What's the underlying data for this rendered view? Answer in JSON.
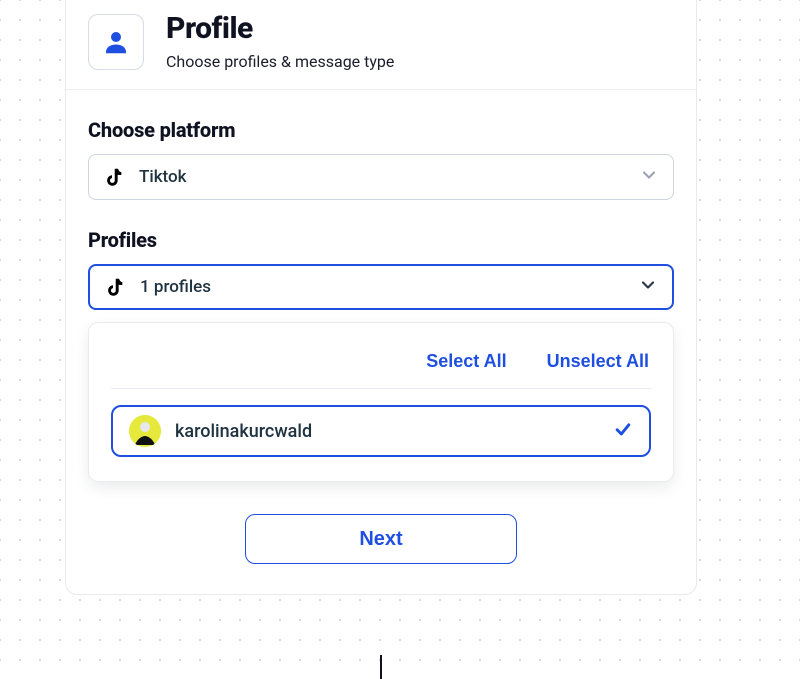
{
  "header": {
    "title": "Profile",
    "subtitle": "Choose profiles & message type",
    "icon": "person-icon"
  },
  "platform": {
    "label": "Choose platform",
    "selected": "Tiktok",
    "icon": "tiktok-icon"
  },
  "profiles": {
    "label": "Profiles",
    "summary": "1 profiles",
    "icon": "tiktok-icon",
    "select_all_label": "Select All",
    "unselect_all_label": "Unselect All",
    "items": [
      {
        "name": "karolinakurcwald",
        "selected": true
      }
    ]
  },
  "next_label": "Next",
  "colors": {
    "primary": "#1f4fe0",
    "text": "#0f1221",
    "muted": "#9aa2b1"
  }
}
